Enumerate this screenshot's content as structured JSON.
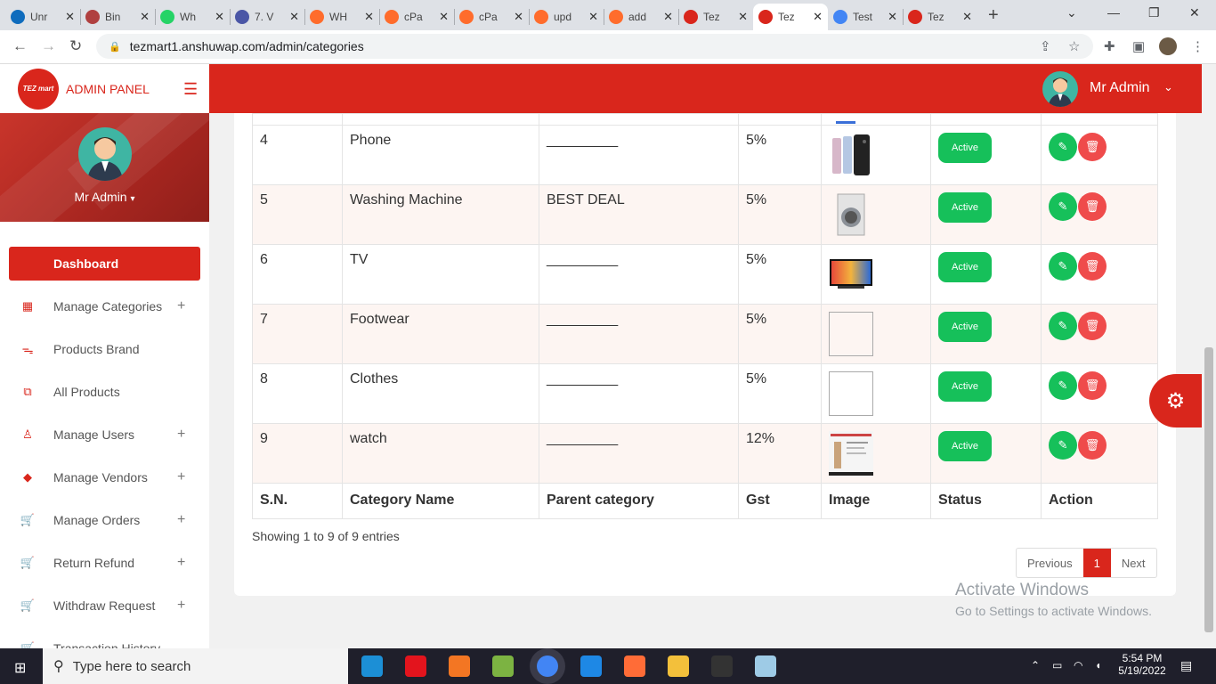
{
  "browser": {
    "tabs": [
      {
        "label": "Unr",
        "icon": "outlook-icon",
        "color": "#0f6cbd"
      },
      {
        "label": "Bin",
        "icon": "bing-icon",
        "color": "#b04040"
      },
      {
        "label": "Wh",
        "icon": "whatsapp-icon",
        "color": "#25d366"
      },
      {
        "label": "7. V",
        "icon": "video-icon",
        "color": "#4a56a6"
      },
      {
        "label": "WH",
        "icon": "cpanel-icon",
        "color": "#ff6c2c"
      },
      {
        "label": "cPa",
        "icon": "cpanel-icon",
        "color": "#ff6c2c"
      },
      {
        "label": "cPa",
        "icon": "cpanel-icon",
        "color": "#ff6c2c"
      },
      {
        "label": "upd",
        "icon": "cpanel-icon",
        "color": "#ff6c2c"
      },
      {
        "label": "add",
        "icon": "cpanel-icon",
        "color": "#ff6c2c"
      },
      {
        "label": "Tez",
        "icon": "tezmart-icon",
        "color": "#d9261c"
      },
      {
        "label": "Tez",
        "icon": "tezmart-icon",
        "color": "#d9261c",
        "active": true
      },
      {
        "label": "Test",
        "icon": "docs-icon",
        "color": "#4285f4"
      },
      {
        "label": "Tez",
        "icon": "tezmart-icon",
        "color": "#d9261c"
      }
    ],
    "url": "tezmart1.anshuwap.com/admin/categories"
  },
  "brand": {
    "logo_text": "TEZ mart",
    "title": "ADMIN PANEL"
  },
  "profile": {
    "name": "Mr Admin"
  },
  "header": {
    "admin_name": "Mr Admin"
  },
  "sidebar": {
    "dashboard_label": "Dashboard",
    "items": [
      {
        "label": "Manage Categories",
        "icon": "grid-icon",
        "glyph": "▦",
        "expandable": true
      },
      {
        "label": "Products Brand",
        "icon": "comments-icon",
        "glyph": "ᯓ",
        "expandable": false
      },
      {
        "label": "All Products",
        "icon": "copy-icon",
        "glyph": "⧉",
        "expandable": false
      },
      {
        "label": "Manage Users",
        "icon": "user-icon",
        "glyph": "♙",
        "expandable": true
      },
      {
        "label": "Manage Vendors",
        "icon": "tag-icon",
        "glyph": "◆",
        "expandable": true
      },
      {
        "label": "Manage Orders",
        "icon": "cart-icon",
        "glyph": "🛒",
        "expandable": true
      },
      {
        "label": "Return Refund",
        "icon": "cart-icon",
        "glyph": "🛒",
        "expandable": true
      },
      {
        "label": "Withdraw Request",
        "icon": "cart-icon",
        "glyph": "🛒",
        "expandable": true
      },
      {
        "label": "Transaction History",
        "icon": "cart-icon",
        "glyph": "🛒",
        "expandable": false
      }
    ]
  },
  "table": {
    "columns": [
      "S.N.",
      "Category Name",
      "Parent category",
      "Gst",
      "Image",
      "Status",
      "Action"
    ],
    "rows": [
      {
        "sn": "4",
        "name": "Phone",
        "parent": "_________",
        "gst": "5%",
        "image": "phone",
        "status": "Active"
      },
      {
        "sn": "5",
        "name": "Washing Machine",
        "parent": "BEST DEAL",
        "gst": "5%",
        "image": "washer",
        "status": "Active"
      },
      {
        "sn": "6",
        "name": "TV",
        "parent": "_________",
        "gst": "5%",
        "image": "tv",
        "status": "Active"
      },
      {
        "sn": "7",
        "name": "Footwear",
        "parent": "_________",
        "gst": "5%",
        "image": "broken",
        "status": "Active"
      },
      {
        "sn": "8",
        "name": "Clothes",
        "parent": "_________",
        "gst": "5%",
        "image": "broken",
        "status": "Active"
      },
      {
        "sn": "9",
        "name": "watch",
        "parent": "_________",
        "gst": "12%",
        "image": "watch",
        "status": "Active"
      }
    ],
    "entries_text": "Showing 1 to 9 of 9 entries",
    "pagination": {
      "prev": "Previous",
      "current": "1",
      "next": "Next"
    }
  },
  "watermark": {
    "line1": "Activate Windows",
    "line2": "Go to Settings to activate Windows."
  },
  "taskbar": {
    "search_placeholder": "Type here to search",
    "apps": [
      {
        "icon": "edge-icon",
        "color": "#1c8fd6"
      },
      {
        "icon": "opera-icon",
        "color": "#e3141d"
      },
      {
        "icon": "xampp-icon",
        "color": "#f37623"
      },
      {
        "icon": "notepadpp-icon",
        "color": "#7cb342"
      },
      {
        "icon": "chrome-icon",
        "color": "#4285f4"
      },
      {
        "icon": "vscode-icon",
        "color": "#1e88e5"
      },
      {
        "icon": "postman-icon",
        "color": "#ff6c37"
      },
      {
        "icon": "file-explorer-icon",
        "color": "#f3c03b"
      },
      {
        "icon": "terminal-icon",
        "color": "#333333"
      },
      {
        "icon": "app-icon",
        "color": "#9ecbe6"
      }
    ],
    "time": "5:54 PM",
    "date": "5/19/2022"
  },
  "colors": {
    "brand_red": "#d9261c",
    "active_green": "#16c05a",
    "delete_red": "#ef4b4b"
  }
}
